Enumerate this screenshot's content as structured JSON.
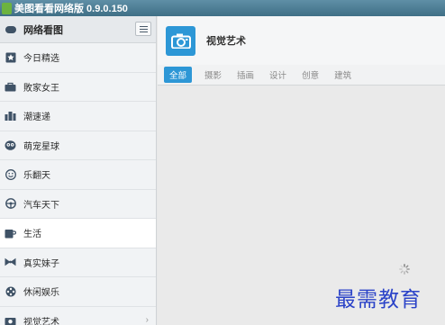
{
  "window": {
    "title": "美图看看网络版 0.9.0.150"
  },
  "sidebar": {
    "header": {
      "label": "网络看图",
      "icon": "cloud-icon",
      "menu_icon": "list-icon"
    },
    "items": [
      {
        "label": "今日精选",
        "icon": "star-icon"
      },
      {
        "label": "敗家女王",
        "icon": "bag-icon"
      },
      {
        "label": "潮速递",
        "icon": "buildings-icon"
      },
      {
        "label": "萌宠星球",
        "icon": "owl-icon"
      },
      {
        "label": "乐翻天",
        "icon": "smiley-icon"
      },
      {
        "label": "汽车天下",
        "icon": "steering-wheel-icon"
      },
      {
        "label": "生活",
        "icon": "cup-icon"
      },
      {
        "label": "真实妹子",
        "icon": "bow-icon"
      },
      {
        "label": "休闲娱乐",
        "icon": "film-reel-icon"
      },
      {
        "label": "视觉艺术",
        "icon": "camera-icon"
      }
    ],
    "active_index": 6
  },
  "main": {
    "category_title": "视觉艺术",
    "category_icon": "camera-icon",
    "tabs": [
      "全部",
      "摄影",
      "插画",
      "设计",
      "创意",
      "建筑"
    ],
    "active_tab": 0,
    "status": "loading"
  },
  "watermark": "最需教育",
  "colors": {
    "accent": "#2d97d6",
    "titlebar": "#4a7a92",
    "watermark": "#2b43c8"
  }
}
